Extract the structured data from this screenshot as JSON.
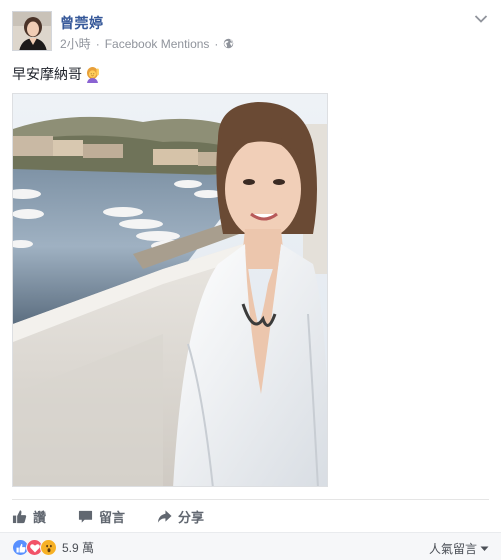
{
  "post": {
    "author": "曾莞婷",
    "time": "2小時",
    "separator": "·",
    "source": "Facebook Mentions",
    "text": "早安摩納哥"
  },
  "actions": {
    "like_label": "讚",
    "comment_label": "留言",
    "share_label": "分享"
  },
  "footer": {
    "reaction_count": "5.9 萬",
    "sort_label": "人氣留言"
  },
  "icons": {
    "audience": "globe-icon",
    "menu": "chevron-down-icon",
    "emoji": "person-raising-hand-emoji",
    "like": "thumbs-up-icon",
    "comment": "speech-bubble-icon",
    "share": "share-arrow-icon",
    "reactions": [
      "like-reaction-icon",
      "love-reaction-icon",
      "wow-reaction-icon"
    ]
  },
  "colors": {
    "author_link": "#365899",
    "like_blue": "#5890ff",
    "love_red": "#f25268",
    "wow_yellow": "#f7b125",
    "meta_gray": "#90949c"
  }
}
